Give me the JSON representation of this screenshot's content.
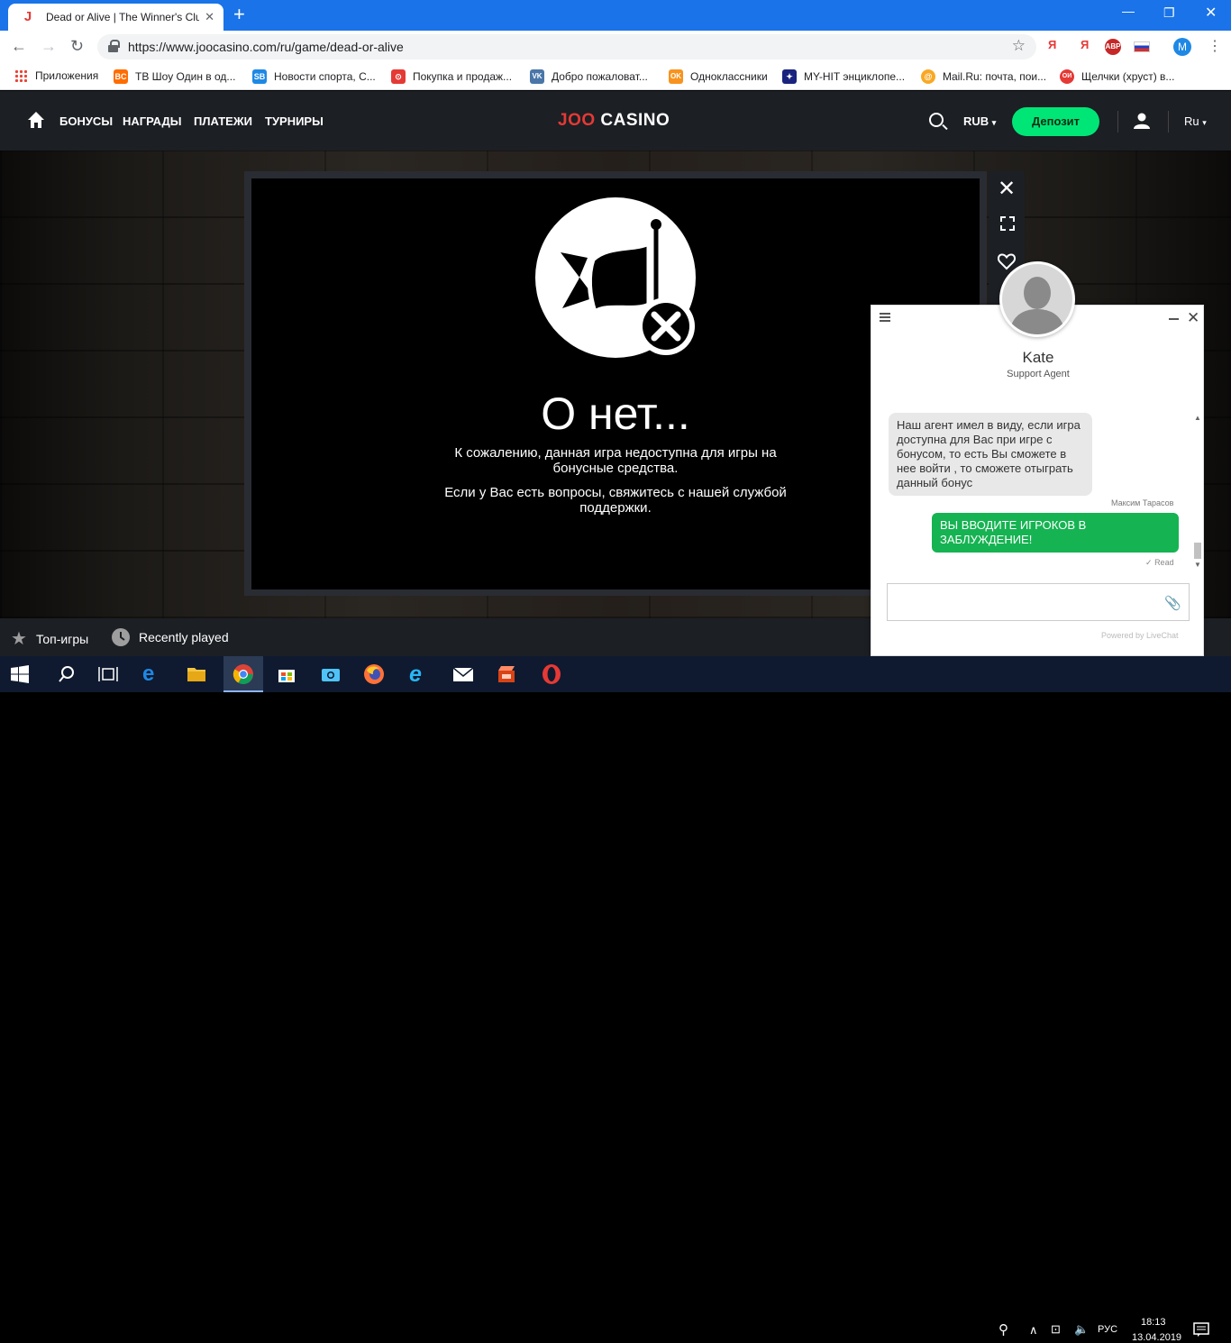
{
  "browser": {
    "tab_title": "Dead or Alive | The Winner's Club",
    "tab_favicon": "J",
    "url": "https://www.joocasino.com/ru/game/dead-or-alive",
    "profile_initial": "M",
    "extensions": [
      "Я",
      "Я",
      "ABP"
    ],
    "bookmarks": [
      {
        "label": "Приложения",
        "icon": "apps-icon"
      },
      {
        "label": "ТВ Шоу Один в од...",
        "icon": "bc-icon",
        "color": "#ff6d00",
        "glyph": "BC"
      },
      {
        "label": "Новости спорта, С...",
        "icon": "sb-icon",
        "color": "#1e88e5",
        "glyph": "SB"
      },
      {
        "label": "Покупка и продаж...",
        "icon": "avito-icon",
        "color": "#e53935",
        "glyph": "⊙"
      },
      {
        "label": "Добро пожаловат...",
        "icon": "vk-icon",
        "color": "#4a76a8",
        "glyph": "VK"
      },
      {
        "label": "Одноклассники",
        "icon": "ok-icon",
        "color": "#f7931e",
        "glyph": "OK"
      },
      {
        "label": "MY-HIT энциклопе...",
        "icon": "myhit-icon",
        "color": "#1a237e",
        "glyph": "✦"
      },
      {
        "label": "Mail.Ru: почта, пои...",
        "icon": "mailru-icon",
        "color": "#f9a825",
        "glyph": "@"
      },
      {
        "label": "Щелчки (хруст) в...",
        "icon": "odnako-icon",
        "color": "#e53935",
        "glyph": "ОИ"
      }
    ]
  },
  "site": {
    "logo_left": "JOO",
    "logo_right": " CASINO",
    "nav": [
      "БОНУСЫ",
      "НАГРАДЫ",
      "ПЛАТЕЖИ",
      "ТУРНИРЫ"
    ],
    "currency": "RUB",
    "deposit_label": "Депозит",
    "language": "Ru"
  },
  "game": {
    "error_title": "О нет...",
    "error_text_1": "К сожалению, данная игра недоступна для игры на бонусные средства.",
    "error_text_2": "Если у Вас есть вопросы, свяжитесь с нашей службой поддержки."
  },
  "bottom_bar": {
    "top_games": "Топ-игры",
    "recently_played": "Recently played"
  },
  "chat": {
    "agent_name": "Kate",
    "agent_role": "Support Agent",
    "agent_message": "Наш агент имел в виду, если игра доступна для Вас при игре с бонусом, то есть Вы сможете в нее войти , то сможете отыграть данный бонус",
    "agent_message_author": "Максим Тарасов",
    "user_message": "ВЫ ВВОДИТЕ ИГРОКОВ В ЗАБЛУЖДЕНИЕ!",
    "read_status": "Read",
    "powered_by": "Powered by LiveChat"
  },
  "taskbar": {
    "language": "РУС",
    "time": "18:13",
    "date": "13.04.2019"
  },
  "colors": {
    "accent_green": "#00e676",
    "logo_red": "#e53935",
    "chrome_blue": "#1a73e8",
    "chat_user_green": "#16b352"
  }
}
